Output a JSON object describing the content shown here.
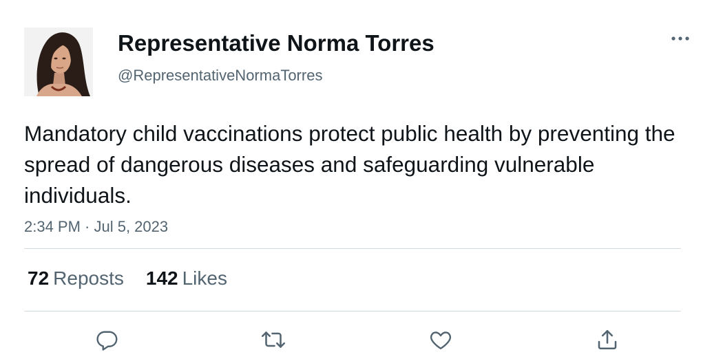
{
  "author": {
    "name": "Representative Norma Torres",
    "handle": "@RepresentativeNormaTorres",
    "avatar_icon": "profile-photo"
  },
  "tweet": {
    "text": "Mandatory child vaccinations protect public health by preventing the spread of dangerous diseases and safeguarding vulnerable individuals.",
    "timestamp": "2:34 PM · Jul 5, 2023"
  },
  "stats": {
    "reposts_count": "72",
    "reposts_label": "Reposts",
    "likes_count": "142",
    "likes_label": "Likes"
  },
  "actions": {
    "reply_icon": "reply-icon",
    "repost_icon": "repost-icon",
    "like_icon": "heart-icon",
    "share_icon": "share-icon",
    "more_icon": "more-dots-icon"
  },
  "colors": {
    "text_primary": "#0f1419",
    "text_secondary": "#536471",
    "divider": "#cfd9de",
    "icon": "#536471"
  }
}
